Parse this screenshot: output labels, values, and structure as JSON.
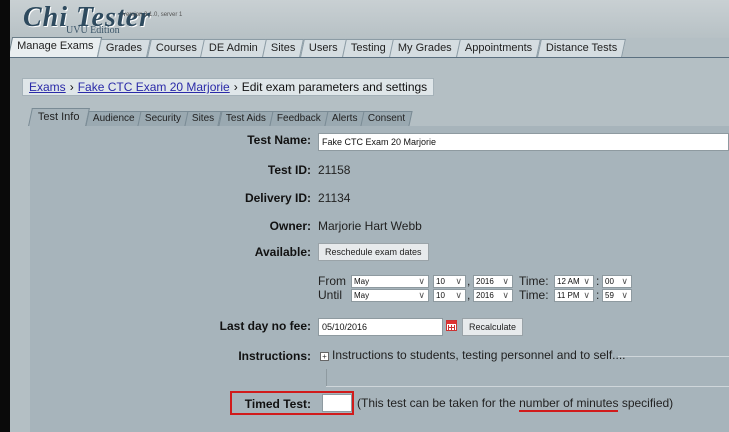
{
  "banner": {
    "logo": "Chi Tester",
    "edition": "UVU Edition",
    "version": "version 3.1.0, server 1"
  },
  "main_tabs": [
    "Manage Exams",
    "Grades",
    "Courses",
    "DE Admin",
    "Sites",
    "Users",
    "Testing",
    "My Grades",
    "Appointments",
    "Distance Tests"
  ],
  "breadcrumb": {
    "root": "Exams",
    "exam": "Fake CTC Exam 20 Marjorie",
    "current": "Edit exam parameters and settings",
    "sep": "›"
  },
  "sub_tabs": [
    "Test Info",
    "Audience",
    "Security",
    "Sites",
    "Test Aids",
    "Feedback",
    "Alerts",
    "Consent"
  ],
  "form": {
    "test_name_label": "Test Name:",
    "test_name_value": "Fake CTC Exam 20 Marjorie",
    "test_id_label": "Test ID:",
    "test_id_value": "21158",
    "delivery_id_label": "Delivery ID:",
    "delivery_id_value": "21134",
    "owner_label": "Owner:",
    "owner_value": "Marjorie Hart Webb",
    "available_label": "Available:",
    "reschedule_button": "Reschedule exam dates",
    "from_label": "From",
    "until_label": "Until",
    "time_label": "Time:",
    "comma": ",",
    "colon": ":",
    "from_month": "May",
    "from_day": "10",
    "from_year": "2016",
    "from_hour": "12 AM",
    "from_minute": "00",
    "until_month": "May",
    "until_day": "10",
    "until_year": "2016",
    "until_hour": "11 PM",
    "until_minute": "59",
    "last_day_label": "Last day no fee:",
    "last_day_value": "05/10/2016",
    "recalculate_button": "Recalculate",
    "instructions_label": "Instructions:",
    "instructions_text": "Instructions to students, testing personnel and to self....",
    "timed_test_label": "Timed Test:",
    "timed_test_value": "",
    "timed_note_pre": "(This test can be taken for the ",
    "timed_note_link": "number of minutes",
    "timed_note_post": " specified)"
  },
  "colors": {
    "highlight": "#d11b1b",
    "link": "#2a2aa8",
    "panel": "#a7b4bb"
  },
  "icons": {
    "calendar": "calendar-icon",
    "expand": "plus-box-icon",
    "dropdown": "chevron-down-icon"
  }
}
